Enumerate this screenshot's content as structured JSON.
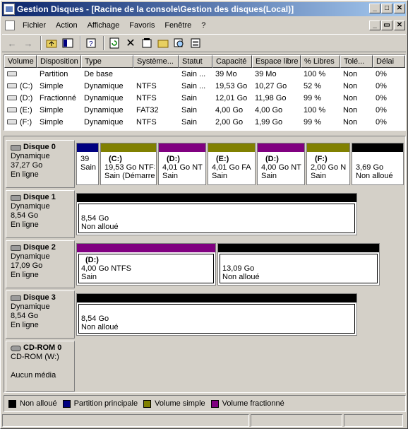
{
  "window": {
    "title": "Gestion Disques - [Racine de la console\\Gestion des disques(Local)]"
  },
  "menu": [
    "Fichier",
    "Action",
    "Affichage",
    "Favoris",
    "Fenêtre",
    "?"
  ],
  "columns": [
    "Volume",
    "Disposition",
    "Type",
    "Système...",
    "Statut",
    "Capacité",
    "Espace libre",
    "% Libres",
    "Tolé...",
    "Délai"
  ],
  "volumes": [
    {
      "volume": "",
      "disposition": "Partition",
      "type": "De base",
      "fs": "",
      "status": "Sain ...",
      "capacity": "39 Mo",
      "free": "39 Mo",
      "pct": "100 %",
      "tol": "Non",
      "delay": "0%"
    },
    {
      "volume": "(C:)",
      "disposition": "Simple",
      "type": "Dynamique",
      "fs": "NTFS",
      "status": "Sain ...",
      "capacity": "19,53 Go",
      "free": "10,27 Go",
      "pct": "52 %",
      "tol": "Non",
      "delay": "0%"
    },
    {
      "volume": "(D:)",
      "disposition": "Fractionné",
      "type": "Dynamique",
      "fs": "NTFS",
      "status": "Sain",
      "capacity": "12,01 Go",
      "free": "11,98 Go",
      "pct": "99 %",
      "tol": "Non",
      "delay": "0%"
    },
    {
      "volume": "(E:)",
      "disposition": "Simple",
      "type": "Dynamique",
      "fs": "FAT32",
      "status": "Sain",
      "capacity": "4,00 Go",
      "free": "4,00 Go",
      "pct": "100 %",
      "tol": "Non",
      "delay": "0%"
    },
    {
      "volume": "(F:)",
      "disposition": "Simple",
      "type": "Dynamique",
      "fs": "NTFS",
      "status": "Sain",
      "capacity": "2,00 Go",
      "free": "1,99 Go",
      "pct": "99 %",
      "tol": "Non",
      "delay": "0%"
    }
  ],
  "disks": [
    {
      "name": "Disque 0",
      "type": "Dynamique",
      "size": "37,27 Go",
      "state": "En ligne"
    },
    {
      "name": "Disque 1",
      "type": "Dynamique",
      "size": "8,54 Go",
      "state": "En ligne"
    },
    {
      "name": "Disque 2",
      "type": "Dynamique",
      "size": "17,09 Go",
      "state": "En ligne"
    },
    {
      "name": "Disque 3",
      "type": "Dynamique",
      "size": "8,54 Go",
      "state": "En ligne"
    },
    {
      "name": "CD-ROM 0",
      "type": "CD-ROM (W:)",
      "size": "",
      "state": "Aucun média"
    }
  ],
  "partitions": {
    "d0": [
      {
        "name": "",
        "l1": "39",
        "l2": "Sain"
      },
      {
        "name": "(C:)",
        "l1": "19,53 Go NTFS",
        "l2": "Sain (Démarre"
      },
      {
        "name": "(D:)",
        "l1": "4,01 Go NT",
        "l2": "Sain"
      },
      {
        "name": "(E:)",
        "l1": "4,01 Go FA",
        "l2": "Sain"
      },
      {
        "name": "(D:)",
        "l1": "4,00 Go NT",
        "l2": "Sain"
      },
      {
        "name": "(F:)",
        "l1": "2,00 Go N",
        "l2": "Sain"
      },
      {
        "name": "",
        "l1": "3,69 Go",
        "l2": "Non alloué"
      }
    ],
    "d1": [
      {
        "name": "",
        "l1": "8,54 Go",
        "l2": "Non alloué"
      }
    ],
    "d2": [
      {
        "name": "(D:)",
        "l1": "4,00 Go NTFS",
        "l2": "Sain"
      },
      {
        "name": "",
        "l1": "13,09 Go",
        "l2": "Non alloué"
      }
    ],
    "d3": [
      {
        "name": "",
        "l1": "8,54 Go",
        "l2": "Non alloué"
      }
    ]
  },
  "legend": [
    {
      "label": "Non alloué",
      "color": "#000000"
    },
    {
      "label": "Partition principale",
      "color": "#000080"
    },
    {
      "label": "Volume simple",
      "color": "#808000"
    },
    {
      "label": "Volume fractionné",
      "color": "#800080"
    }
  ]
}
